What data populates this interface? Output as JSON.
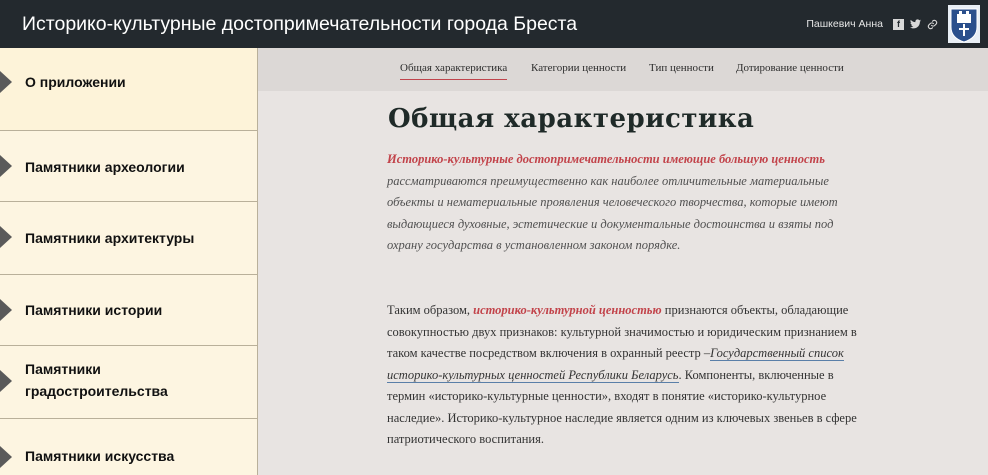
{
  "header": {
    "title": "Историко-культурные достопримечательности города Бреста",
    "author": "Пашкевич Анна",
    "social": [
      {
        "name": "facebook-icon",
        "glyph": "f"
      },
      {
        "name": "twitter-icon",
        "glyph": "🐦"
      },
      {
        "name": "link-icon",
        "glyph": "🔗"
      }
    ],
    "colors": {
      "bar": "#23292e",
      "emblem_blue": "#2a4f8c"
    }
  },
  "sidebar": {
    "items": [
      {
        "label": "О приложении",
        "active": true
      },
      {
        "label": "Памятники археологии",
        "active": false
      },
      {
        "label": "Памятники архитектуры",
        "active": false
      },
      {
        "label": "Памятники истории",
        "active": false
      },
      {
        "label": "Памятники\nградостроительства",
        "active": false
      },
      {
        "label": "Памятники искусства",
        "active": false
      }
    ]
  },
  "tabs": [
    {
      "label": "Общая характеристика",
      "active": true
    },
    {
      "label": "Категории ценности",
      "active": false
    },
    {
      "label": "Тип ценности",
      "active": false
    },
    {
      "label": "Дотирование ценности",
      "active": false
    }
  ],
  "main": {
    "heading": "Общая характеристика",
    "para1_highlight": "Историко-культурные достопримечательности имеющие большую ценность",
    "para1_rest": "рассматриваются преимущественно как наиболее отличительные материальные объекты и нематериальные проявления человеческого творчества, которые имеют выдающиеся духовные, эстетические и документальные достоинства и взяты под охрану государства в установленном законом порядке.",
    "para2_start": "Таким образом, ",
    "para2_highlight": "историко-культурной ценностью",
    "para2_mid": " признаются объекты, обладающие совокупностью двух признаков: культурной значимостью и юридическим признанием в таком качестве посредством включения в охранный реестр –",
    "para2_link": "Государственный список историко-культурных ценностей Республики Беларусь",
    "para2_end": ". Компоненты, включенные в термин «историко-культурные ценности», входят в понятие «историко-культурное наследие». Историко-культурное наследие является одним из ключевых звеньев в сфере патриотического воспитания."
  }
}
